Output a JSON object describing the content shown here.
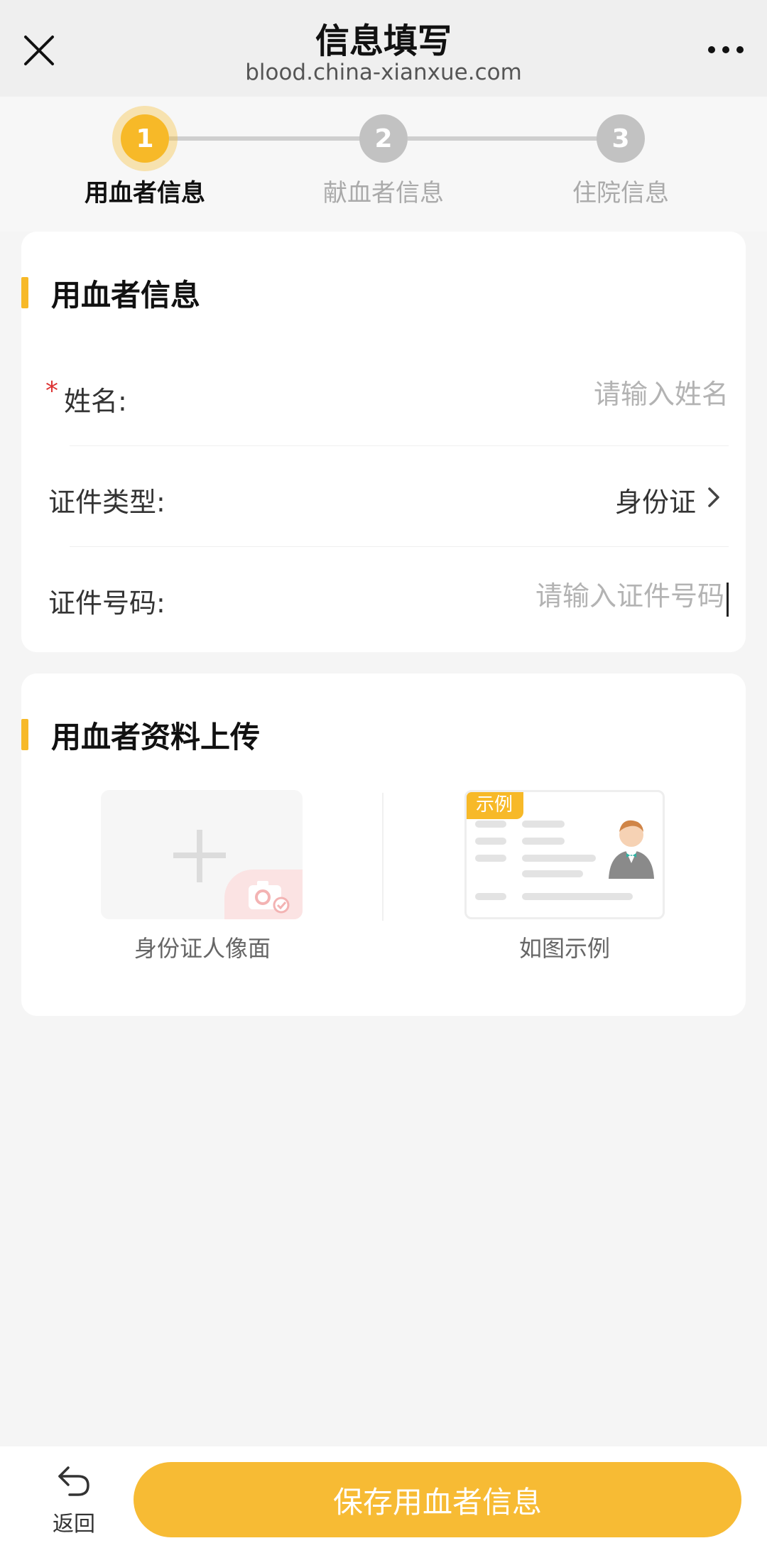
{
  "nav": {
    "title": "信息填写",
    "url": "blood.china-xianxue.com"
  },
  "steps": [
    {
      "number": "1",
      "label": "用血者信息",
      "active": true
    },
    {
      "number": "2",
      "label": "献血者信息",
      "active": false
    },
    {
      "number": "3",
      "label": "住院信息",
      "active": false
    }
  ],
  "section1": {
    "title": "用血者信息",
    "name": {
      "required_mark": "*",
      "label": "姓名:",
      "placeholder": "请输入姓名",
      "value": ""
    },
    "id_type": {
      "label": "证件类型:",
      "value": "身份证"
    },
    "id_number": {
      "label": "证件号码:",
      "placeholder": "请输入证件号码",
      "value": ""
    }
  },
  "section2": {
    "title": "用血者资料上传",
    "upload_label": "身份证人像面",
    "example_tag": "示例",
    "example_label": "如图示例"
  },
  "bottom": {
    "back_label": "返回",
    "save_label": "保存用血者信息"
  },
  "colors": {
    "accent": "#f7b928",
    "required": "#d33333"
  }
}
